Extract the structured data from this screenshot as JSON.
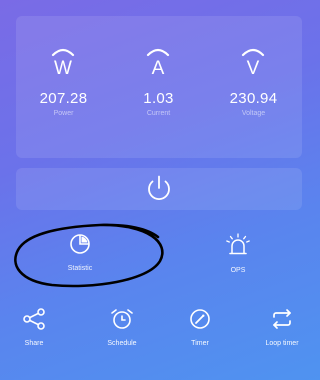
{
  "metrics": [
    {
      "value": "207.28",
      "label": "Power",
      "icon": "W",
      "icon_name": "power-watt-icon"
    },
    {
      "value": "1.03",
      "label": "Current",
      "icon": "A",
      "icon_name": "current-amp-icon"
    },
    {
      "value": "230.94",
      "label": "Voltage",
      "icon": "V",
      "icon_name": "voltage-icon"
    }
  ],
  "features": {
    "statistic": {
      "label": "Statistic",
      "icon_name": "pie-chart-icon"
    },
    "ops": {
      "label": "OPS",
      "icon_name": "alarm-light-icon"
    }
  },
  "toolbar": {
    "share": {
      "label": "Share",
      "icon_name": "share-icon"
    },
    "schedule": {
      "label": "Schedule",
      "icon_name": "alarm-clock-icon"
    },
    "timer": {
      "label": "Timer",
      "icon_name": "stopwatch-icon"
    },
    "loop_timer": {
      "label": "Loop timer",
      "icon_name": "loop-icon"
    }
  },
  "colors": {
    "gradient_start": "#7a6be6",
    "gradient_end": "#4f93f0",
    "annotation": "#000000"
  }
}
